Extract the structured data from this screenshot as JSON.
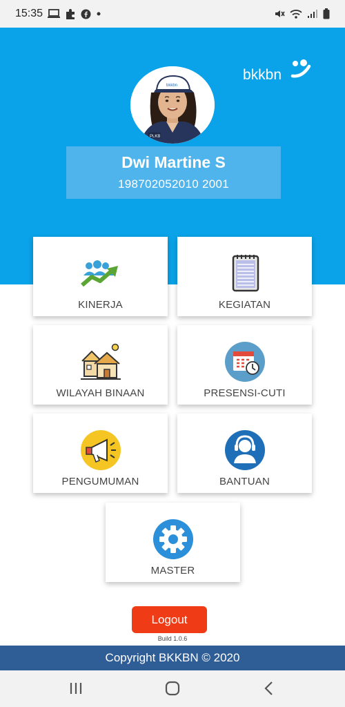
{
  "status_bar": {
    "time": "15:35",
    "left_icons": [
      "laptop-icon",
      "puzzle-icon",
      "facebook-icon",
      "dot-icon"
    ],
    "right_icons": [
      "mute-icon",
      "wifi-icon",
      "signal-icon",
      "battery-icon"
    ]
  },
  "header": {
    "logo_text": "bkkbn",
    "avatar_cap_text": "bkkbn",
    "avatar_vest_text": "PLKB"
  },
  "profile": {
    "name": "Dwi Martine S",
    "id": "198702052010 2001"
  },
  "menu": [
    {
      "label": "KINERJA",
      "icon": "performance-chart-icon"
    },
    {
      "label": "KEGIATAN",
      "icon": "notepad-icon"
    },
    {
      "label": "WILAYAH BINAAN",
      "icon": "houses-icon"
    },
    {
      "label": "PRESENSI-CUTI",
      "icon": "calendar-clock-icon"
    },
    {
      "label": "PENGUMUMAN",
      "icon": "megaphone-icon"
    },
    {
      "label": "BANTUAN",
      "icon": "support-agent-icon"
    },
    {
      "label": "MASTER",
      "icon": "gear-icon"
    }
  ],
  "logout": {
    "label": "Logout"
  },
  "build": "Build 1.0.6",
  "footer": {
    "copyright": "Copyright BKKBN © 2020"
  },
  "colors": {
    "header_bg": "#0aa2e8",
    "profile_box": "#4fb3ec",
    "logout_bg": "#f03c16",
    "footer_bg": "#2f5d96"
  }
}
